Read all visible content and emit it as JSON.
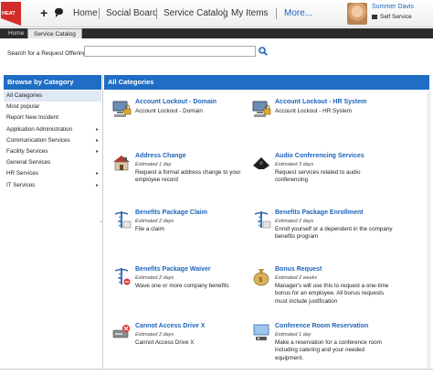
{
  "topbar": {
    "logo_text": "HEAT",
    "nav": [
      "Home",
      "Social Board",
      "Service Catalog",
      "My Items"
    ],
    "more": "More...",
    "user_name": "Summer Davis",
    "user_role": "Self Service"
  },
  "tabs": [
    "Home",
    "Service Catalog"
  ],
  "search": {
    "label": "Search for a Request Offering:",
    "value": "",
    "placeholder": ""
  },
  "left": {
    "header": "Browse by Category",
    "items": [
      {
        "label": "All Categories",
        "arrow": ""
      },
      {
        "label": "Most popular",
        "arrow": ""
      },
      {
        "label": "Report New Incident",
        "arrow": ""
      },
      {
        "label": "Application Administration",
        "arrow": "▸"
      },
      {
        "label": "Communication Services",
        "arrow": "▸"
      },
      {
        "label": "Facility Services",
        "arrow": "▸"
      },
      {
        "label": "General Services",
        "arrow": ""
      },
      {
        "label": "HR Services",
        "arrow": "▸"
      },
      {
        "label": "IT Services",
        "arrow": "▸"
      }
    ]
  },
  "right": {
    "header": "All Categories",
    "offerings": [
      {
        "title": "Account Lockout - Domain",
        "estimate": "",
        "description": "Account Lockout - Domain",
        "icon": "computer-lock-icon"
      },
      {
        "title": "Account Lockout - HR System",
        "estimate": "",
        "description": "Account Lockout - HR System",
        "icon": "computer-lock-icon"
      },
      {
        "title": "Address Change",
        "estimate": "Estimated 1 day",
        "description": "Request a formal address change to your employee record",
        "icon": "house-icon"
      },
      {
        "title": "Audio Conferencing Services",
        "estimate": "Estimated 3 days",
        "description": "Request services related to audio conferencing",
        "icon": "conference-phone-icon"
      },
      {
        "title": "Benefits Package Claim",
        "estimate": "Estimated 2 days",
        "description": "File a claim",
        "icon": "medical-caduceus-icon"
      },
      {
        "title": "Benefits Package Enrollment",
        "estimate": "Estimated 2 days",
        "description": "Enroll yourself or a dependent in the company benefits program",
        "icon": "medical-caduceus-icon"
      },
      {
        "title": "Benefits Package Waiver",
        "estimate": "Estimated 2 days",
        "description": "Wave one or more company benefits",
        "icon": "medical-caduceus-icon"
      },
      {
        "title": "Bonus Request",
        "estimate": "Estimated 2 weeks",
        "description": "Manager's will use this to request a one-time bonus for an employee. All bonus requests must include justification",
        "icon": "money-bag-icon"
      },
      {
        "title": "Cannot Access Drive X",
        "estimate": "Estimated 2 days",
        "description": "Cannot Access Drive X",
        "icon": "drive-error-icon"
      },
      {
        "title": "Conference Room Reservation",
        "estimate": "Estimated 1 day",
        "description": "Make a reservation for a conference room including catering and your needed equipment.",
        "icon": "projector-screen-icon"
      }
    ]
  }
}
